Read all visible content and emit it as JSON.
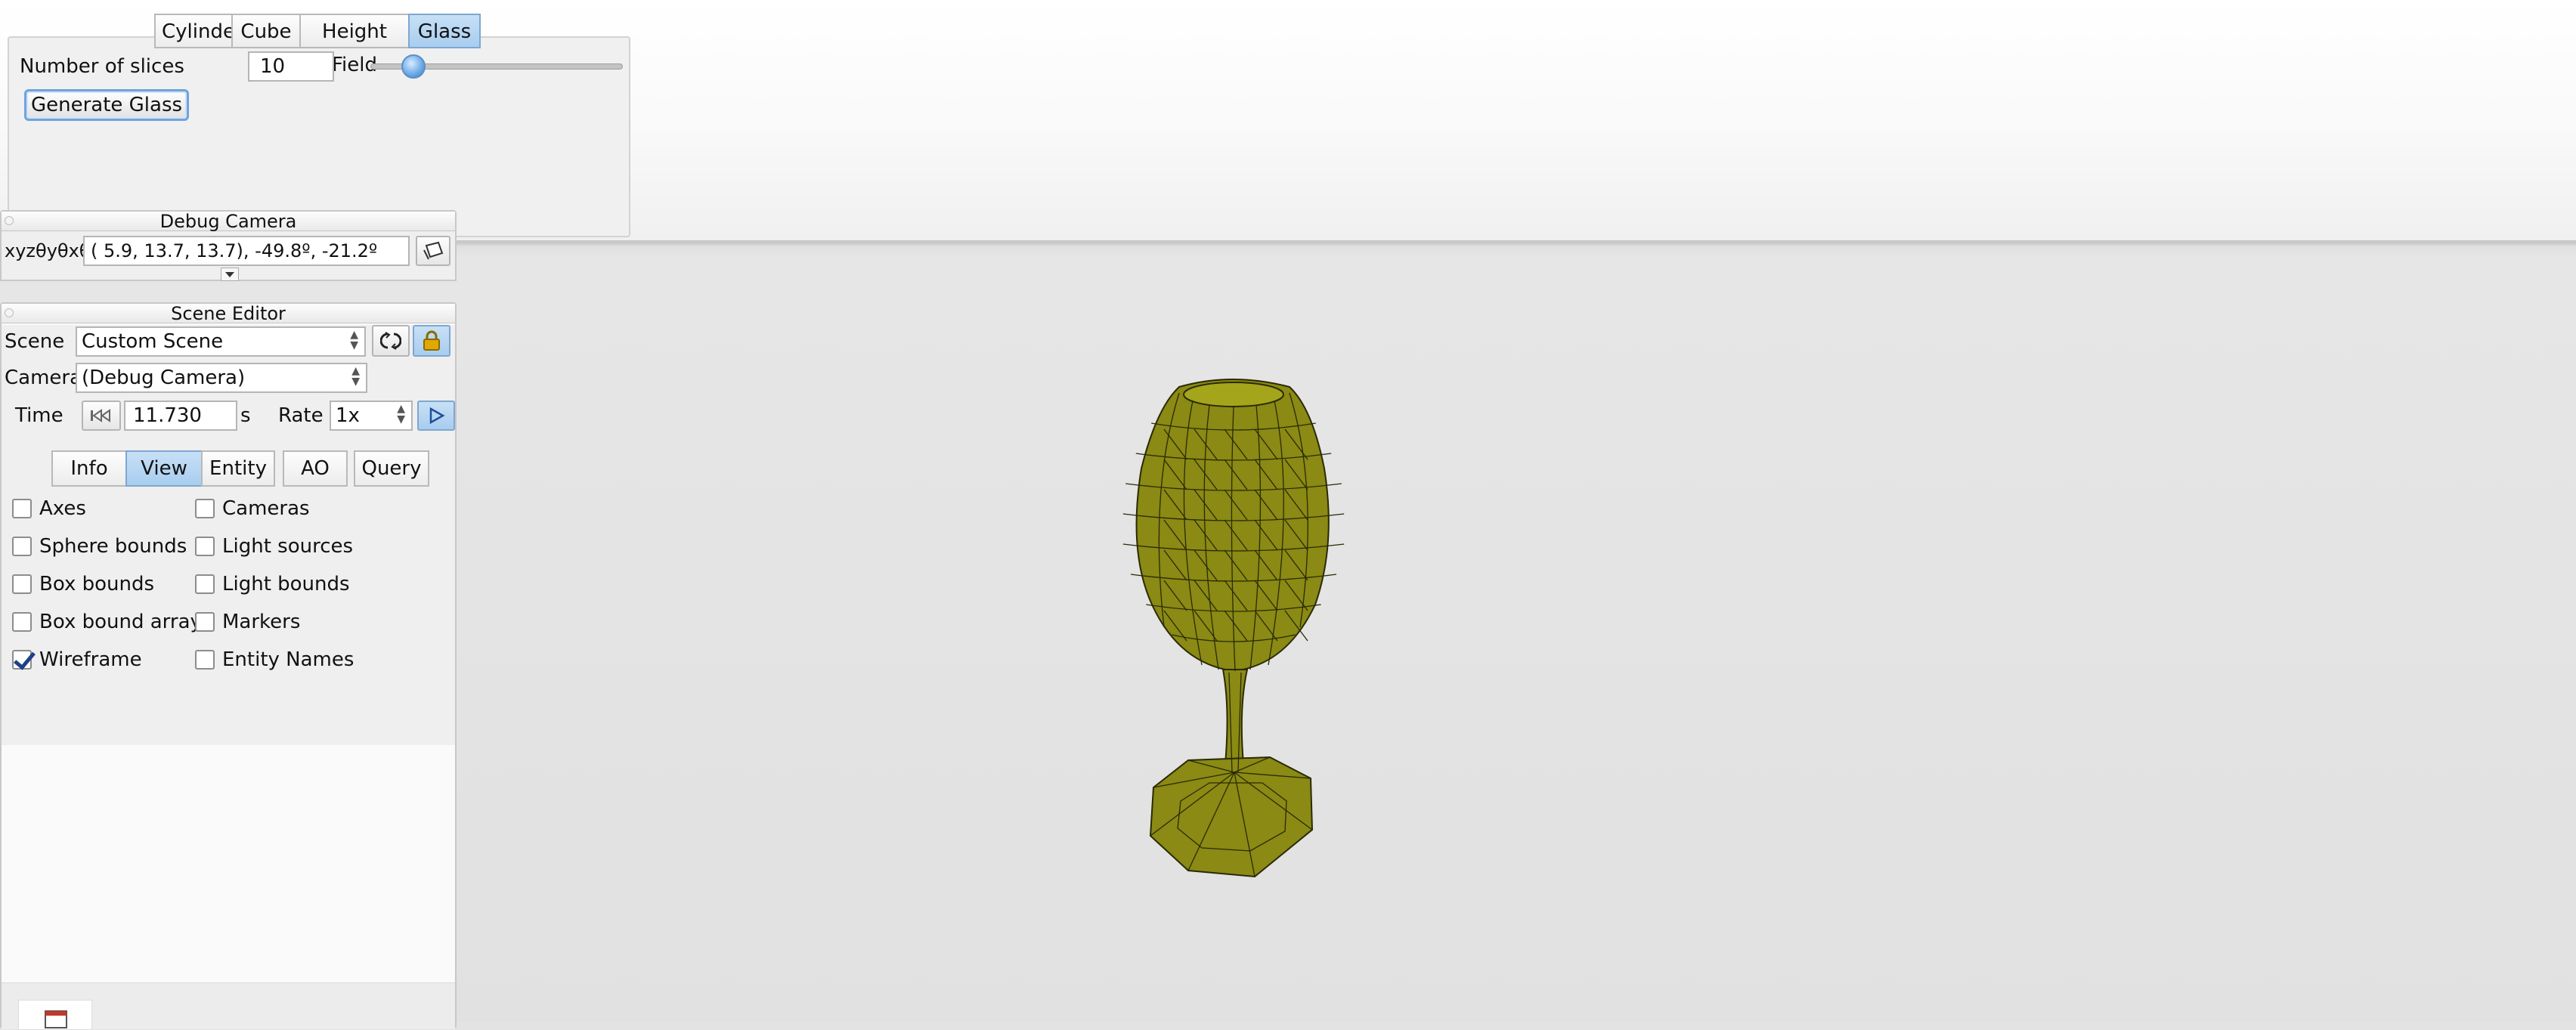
{
  "glass_panel": {
    "tabs": [
      {
        "label": "Cylinder",
        "active": false
      },
      {
        "label": "Cube",
        "active": false
      },
      {
        "label": "Height Field",
        "active": false
      },
      {
        "label": "Glass",
        "active": true
      }
    ],
    "slices_label": "Number of slices",
    "slices_value": "10",
    "slider_fraction": 0.17,
    "generate_label": "Generate Glass"
  },
  "debug_camera": {
    "title": "Debug Camera",
    "coord_label": "xyzθyθxθz",
    "coord_value": "(  5.9,  13.7,  13.7), -49.8º, -21.2º",
    "copy_icon": "clipboard-icon",
    "expand_icon": "triangle-down-icon"
  },
  "scene_editor": {
    "title": "Scene Editor",
    "scene_label": "Scene",
    "scene_value": "Custom Scene",
    "camera_label": "Camera",
    "camera_value": "(Debug Camera)",
    "time_label": "Time",
    "time_value": "11.730",
    "time_unit": "s",
    "rate_label": "Rate",
    "rate_value": "1x",
    "reload_icon": "reload-icon",
    "lock_icon": "lock-icon",
    "rewind_icon": "rewind-icon",
    "play_icon": "play-icon",
    "tabs": [
      {
        "label": "Info",
        "active": false
      },
      {
        "label": "View",
        "active": true
      },
      {
        "label": "Entity",
        "active": false
      },
      {
        "label": "AO",
        "active": false
      },
      {
        "label": "Query",
        "active": false
      }
    ],
    "checks_left": [
      {
        "label": "Axes",
        "checked": false
      },
      {
        "label": "Sphere bounds",
        "checked": false
      },
      {
        "label": "Box bounds",
        "checked": false
      },
      {
        "label": "Box bound array",
        "checked": false
      },
      {
        "label": "Wireframe",
        "checked": true
      }
    ],
    "checks_right": [
      {
        "label": "Cameras",
        "checked": false
      },
      {
        "label": "Light sources",
        "checked": false
      },
      {
        "label": "Light bounds",
        "checked": false
      },
      {
        "label": "Markers",
        "checked": false
      },
      {
        "label": "Entity Names",
        "checked": false
      }
    ],
    "bottom_icon": "window-icon"
  },
  "colors": {
    "mesh_fill": "#8a8a14",
    "mesh_fill_light": "#a5a51c",
    "mesh_edge": "#2a2a05",
    "tab_active": "#a8cdef"
  }
}
